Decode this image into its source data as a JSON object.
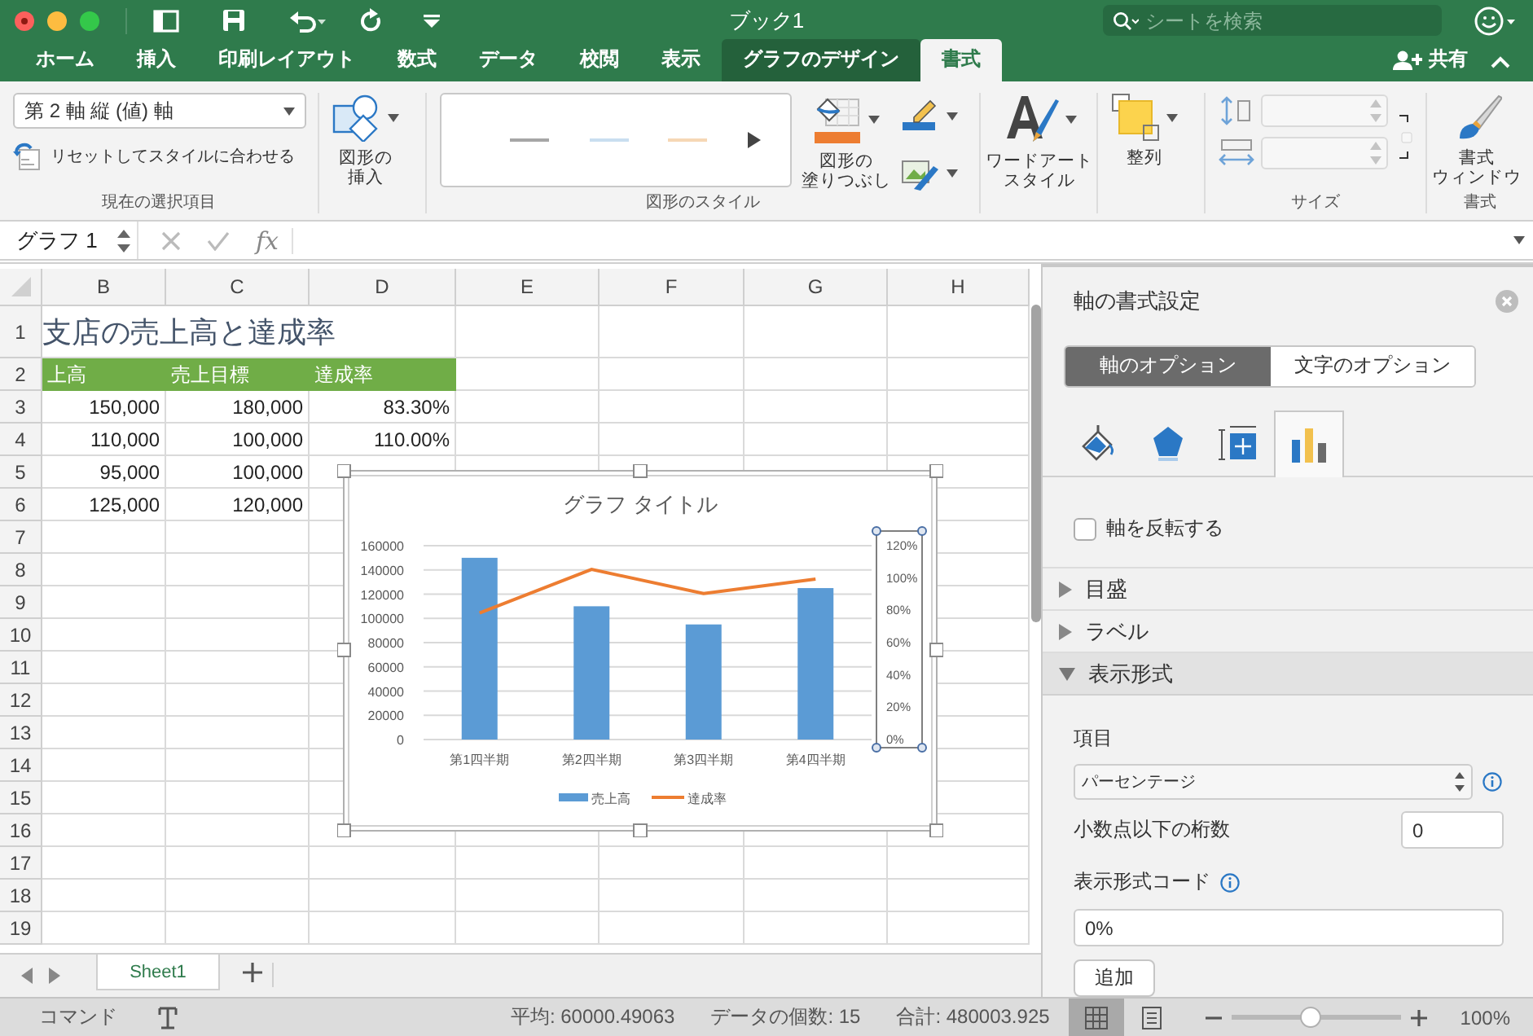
{
  "window": {
    "title": "ブック1",
    "search": {
      "placeholder": "シートを検索"
    }
  },
  "ribbon_tabs": [
    {
      "label": "ホーム",
      "selected": false,
      "contextual": false
    },
    {
      "label": "挿入",
      "selected": false,
      "contextual": false
    },
    {
      "label": "印刷レイアウト",
      "selected": false,
      "contextual": false
    },
    {
      "label": "数式",
      "selected": false,
      "contextual": false
    },
    {
      "label": "データ",
      "selected": false,
      "contextual": false
    },
    {
      "label": "校閲",
      "selected": false,
      "contextual": false
    },
    {
      "label": "表示",
      "selected": false,
      "contextual": false
    },
    {
      "label": "グラフのデザイン",
      "selected": false,
      "contextual": true
    },
    {
      "label": "書式",
      "selected": true,
      "contextual": true
    }
  ],
  "share": {
    "label": "共有"
  },
  "ribbon": {
    "selection": {
      "element": "第 2 軸 縦 (値) 軸",
      "reset_label": "リセットしてスタイルに合わせる",
      "group_label": "現在の選択項目"
    },
    "insert_shape": {
      "label_lines": [
        "図形の",
        "挿入"
      ]
    },
    "shape_styles": {
      "samples": [
        {
          "color": "#a6a6a6"
        },
        {
          "color": "#c9def0"
        },
        {
          "color": "#f6d7b5"
        }
      ],
      "fill_label_lines": [
        "図形の",
        "塗りつぶし"
      ],
      "group_label": "図形のスタイル"
    },
    "wordart": {
      "label_lines": [
        "ワードアート",
        "スタイル"
      ]
    },
    "arrange": {
      "label": "整列"
    },
    "size": {
      "group_label": "サイズ",
      "disabled": true
    },
    "format_pane": {
      "label_lines": [
        "書式",
        "ウィンドウ"
      ],
      "group_label": "書式"
    }
  },
  "formula_bar": {
    "name_box": "グラフ 1",
    "function_label": "fx"
  },
  "sheet": {
    "columns": [
      "B",
      "C",
      "D",
      "E",
      "F",
      "G",
      "H"
    ],
    "rows": [
      "1",
      "2",
      "3",
      "4",
      "5",
      "6",
      "7",
      "8",
      "9",
      "10",
      "11",
      "12",
      "13",
      "14",
      "15",
      "16",
      "17",
      "18",
      "19"
    ],
    "title": "支店の売上高と達成率",
    "header": [
      "上高",
      "売上目標",
      "達成率"
    ],
    "data": [
      [
        "150,000",
        "180,000",
        "83.30%"
      ],
      [
        "110,000",
        "100,000",
        "110.00%"
      ],
      [
        "95,000",
        "100,000"
      ],
      [
        "125,000",
        "120,000"
      ]
    ]
  },
  "chart": {
    "title": "グラフ タイトル",
    "chart_data": {
      "type": "bar",
      "categories": [
        "第1四半期",
        "第2四半期",
        "第3四半期",
        "第4四半期"
      ],
      "series": [
        {
          "name": "売上高",
          "color": "#5b9bd5",
          "type": "bar",
          "values": [
            150000,
            110000,
            95000,
            125000
          ]
        },
        {
          "name": "達成率",
          "color": "#ed7d31",
          "type": "line",
          "axis": "y2",
          "values": [
            0.83,
            1.1,
            0.95,
            1.04
          ]
        }
      ],
      "grid": true,
      "legend": "bottom",
      "ylim": [
        0,
        160000
      ],
      "y2lim": [
        0,
        1.2
      ],
      "yticks": [
        0,
        20000,
        40000,
        60000,
        80000,
        100000,
        120000,
        140000,
        160000
      ],
      "y2ticks": [
        {
          "value": 0,
          "label": "0%"
        },
        {
          "value": 0.2,
          "label": "20%"
        },
        {
          "value": 0.4,
          "label": "40%"
        },
        {
          "value": 0.6,
          "label": "60%"
        },
        {
          "value": 0.8,
          "label": "80%"
        },
        {
          "value": 1,
          "label": "100%"
        },
        {
          "value": 1.2,
          "label": "120%"
        }
      ]
    }
  },
  "sheet_tabs": [
    {
      "label": "Sheet1",
      "selected": true
    }
  ],
  "panel": {
    "title": "軸の書式設定",
    "option_tabs": [
      {
        "label": "軸のオプション",
        "selected": true
      },
      {
        "label": "文字のオプション",
        "selected": false
      }
    ],
    "icon_tabs": [
      {
        "kind": "fill",
        "selected": false
      },
      {
        "kind": "effects",
        "selected": false
      },
      {
        "kind": "size",
        "selected": false
      },
      {
        "kind": "axis",
        "selected": true
      }
    ],
    "reverse_checkbox": {
      "label": "軸を反転する",
      "checked": false
    },
    "sections": [
      {
        "label": "目盛",
        "expanded": false
      },
      {
        "label": "ラベル",
        "expanded": false
      },
      {
        "label": "表示形式",
        "expanded": true
      }
    ],
    "number": {
      "category_label": "項目",
      "category": "パーセンテージ",
      "decimals_label": "小数点以下の桁数",
      "decimals": "0",
      "code_label": "表示形式コード",
      "code": "0%",
      "add_button": "追加"
    }
  },
  "status_bar": {
    "mode": "コマンド",
    "average": "平均: 60000.49063",
    "count": "データの個数: 15",
    "sum": "合計: 480003.925",
    "views": [
      {
        "kind": "normal",
        "selected": true
      },
      {
        "kind": "page",
        "selected": false
      }
    ],
    "zoom": {
      "level": 0.45,
      "reading": "100%"
    }
  }
}
